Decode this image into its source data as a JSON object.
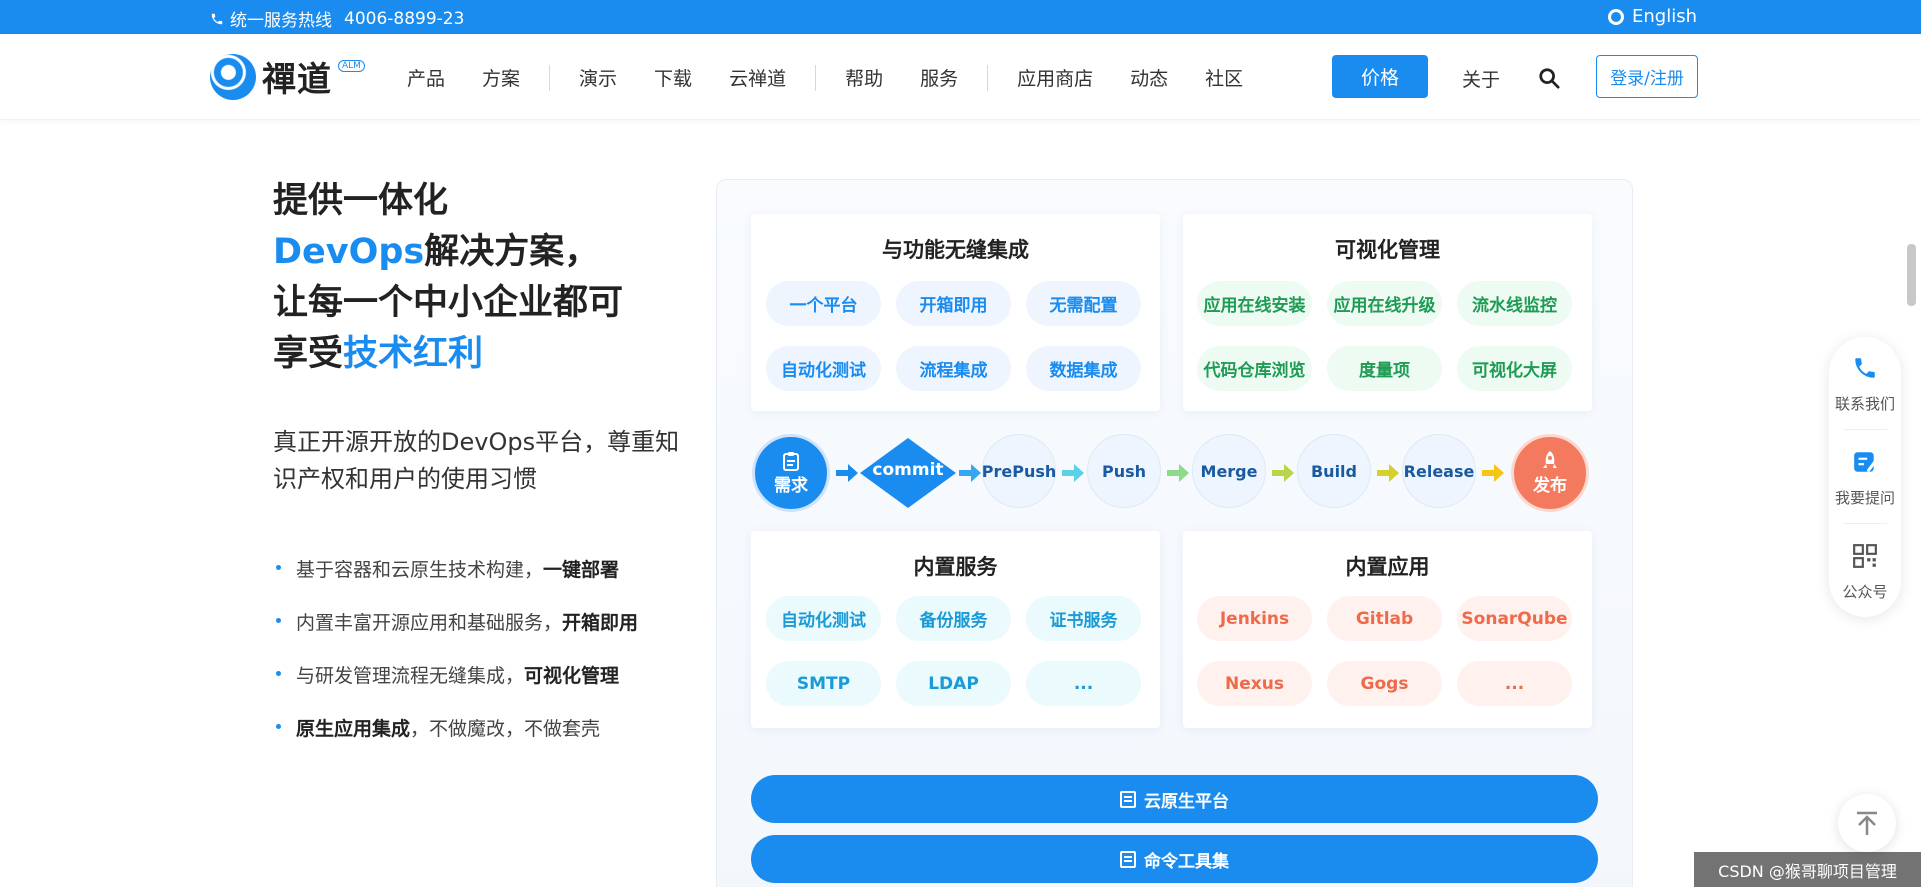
{
  "topbar": {
    "hotline_label": "统一服务热线",
    "hotline_number": "4006-8899-23",
    "language": "English"
  },
  "nav": {
    "logo_text": "禪道",
    "logo_badge": "ALM",
    "menu": [
      "产品",
      "方案",
      "演示",
      "下载",
      "云禅道",
      "帮助",
      "服务",
      "应用商店",
      "动态",
      "社区"
    ],
    "price": "价格",
    "about": "关于",
    "login": "登录/注册"
  },
  "hero": {
    "line1": "提供一体化",
    "line2_blue": "DevOps",
    "line2_rest": "解决方案，",
    "line3": "让每一个中小企业都可",
    "line4_pre": "享受",
    "line4_blue": "技术红利",
    "sub": "真正开源开放的DevOps平台，尊重知识产权和用户的使用习惯",
    "features": [
      {
        "text": "基于容器和云原生技术构建，",
        "bold": "一键部署",
        "bold_first": false
      },
      {
        "text": "内置丰富开源应用和基础服务，",
        "bold": "开箱即用",
        "bold_first": false
      },
      {
        "text": "与研发管理流程无缝集成，",
        "bold": "可视化管理",
        "bold_first": false
      },
      {
        "text": "，不做魔改，不做套壳",
        "bold": "原生应用集成",
        "bold_first": true
      }
    ]
  },
  "diagram": {
    "card_integration": {
      "title": "与功能无缝集成",
      "items": [
        "一个平台",
        "开箱即用",
        "无需配置",
        "自动化测试",
        "流程集成",
        "数据集成"
      ]
    },
    "card_visual": {
      "title": "可视化管理",
      "items": [
        "应用在线安装",
        "应用在线升级",
        "流水线监控",
        "代码仓库浏览",
        "度量项",
        "可视化大屏"
      ]
    },
    "card_services": {
      "title": "内置服务",
      "items": [
        "自动化测试",
        "备份服务",
        "证书服务",
        "SMTP",
        "LDAP",
        "..."
      ]
    },
    "card_apps": {
      "title": "内置应用",
      "items": [
        "Jenkins",
        "Gitlab",
        "SonarQube",
        "Nexus",
        "Gogs",
        "..."
      ]
    },
    "pipeline": {
      "start": "需求",
      "commit": "commit",
      "stages": [
        "PrePush",
        "Push",
        "Merge",
        "Build",
        "Release"
      ],
      "end": "发布"
    },
    "buttons": [
      "云原生平台",
      "命令工具集"
    ]
  },
  "side": {
    "contact": "联系我们",
    "ask": "我要提问",
    "official": "公众号"
  },
  "watermark": "CSDN @猴哥聊项目管理",
  "colors": {
    "brand_blue": "#1a8cf0",
    "green": "#1e9b54",
    "orange": "#ef6a4a",
    "cyan": "#1a9ad6"
  }
}
